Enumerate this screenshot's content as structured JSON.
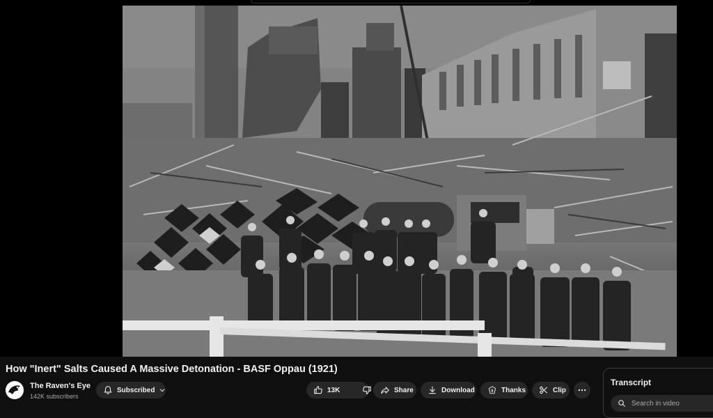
{
  "video": {
    "title": "How \"Inert\" Salts Caused A Massive Detonation - BASF Oppau (1921)"
  },
  "channel": {
    "name": "The Raven's Eye",
    "subscribers": "142K subscribers",
    "subscribe_label": "Subscribed"
  },
  "actions": {
    "likes": "13K",
    "share": "Share",
    "download": "Download",
    "thanks": "Thanks",
    "clip": "Clip"
  },
  "transcript": {
    "title": "Transcript",
    "search_placeholder": "Search in video"
  }
}
